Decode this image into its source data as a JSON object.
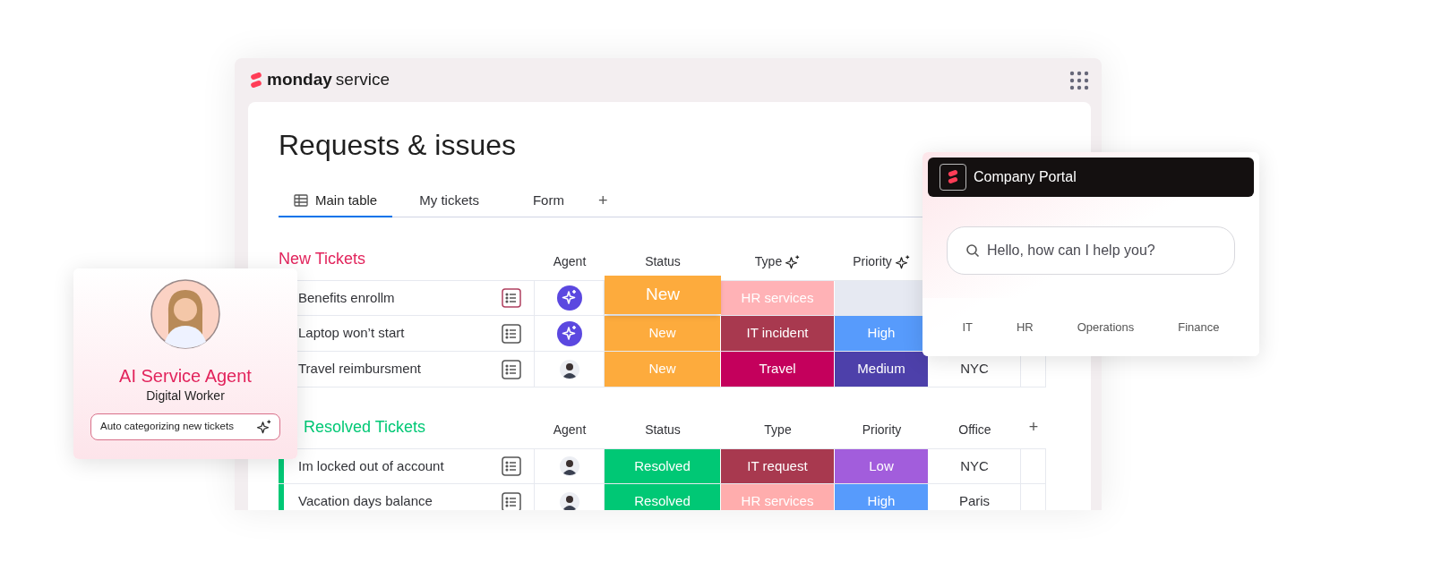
{
  "brand": {
    "name": "monday",
    "product": "service"
  },
  "board": {
    "title": "Requests & issues",
    "tabs": [
      {
        "label": "Main table",
        "selected": true
      },
      {
        "label": "My tickets",
        "selected": false
      },
      {
        "label": "Form",
        "selected": false
      }
    ],
    "add_tab": "+"
  },
  "groups": [
    {
      "title": "New Tickets",
      "color": "#e2245c",
      "columns": [
        {
          "label": "Agent",
          "ai": false
        },
        {
          "label": "Status",
          "ai": false
        },
        {
          "label": "Type",
          "ai": true
        },
        {
          "label": "Priority",
          "ai": true
        }
      ],
      "rows": [
        {
          "name": "Benefits enrollm",
          "agent": {
            "kind": "ai"
          },
          "status": {
            "label": "New",
            "color": "#fdab3d",
            "emphasized": true
          },
          "type": {
            "label": "HR services",
            "color": "#ffb2b6"
          },
          "priority": {
            "color": "#e6e9f2"
          }
        },
        {
          "name": "Laptop won’t start",
          "agent": {
            "kind": "ai"
          },
          "status": {
            "label": "New",
            "color": "#fdab3d",
            "emphasized": false
          },
          "type": {
            "label": "IT incident",
            "color": "#a8394f"
          },
          "priority": {
            "label": "High",
            "color": "#579bfc"
          }
        },
        {
          "name": "Travel reimbursment",
          "agent": {
            "kind": "person"
          },
          "status": {
            "label": "New",
            "color": "#fdab3d",
            "emphasized": false
          },
          "type": {
            "label": "Travel",
            "color": "#c4005c"
          },
          "priority": {
            "label": "Medium",
            "color": "#4d40aa"
          },
          "office": "NYC"
        }
      ]
    },
    {
      "title": "Resolved Tickets",
      "color": "#00c875",
      "columns": [
        {
          "label": "Agent",
          "ai": false
        },
        {
          "label": "Status",
          "ai": false
        },
        {
          "label": "Type",
          "ai": false
        },
        {
          "label": "Priority",
          "ai": false
        },
        {
          "label": "Office",
          "ai": false
        }
      ],
      "add_column": "+",
      "rows": [
        {
          "name": "Im locked out of account",
          "agent": {
            "kind": "person"
          },
          "status": {
            "label": "Resolved",
            "color": "#00c875",
            "emphasized": false
          },
          "type": {
            "label": "IT request",
            "color": "#a8394f"
          },
          "priority": {
            "label": "Low",
            "color": "#a25ddc"
          },
          "office": "NYC"
        },
        {
          "name": "Vacation days balance",
          "agent": {
            "kind": "person"
          },
          "status": {
            "label": "Resolved",
            "color": "#00c875",
            "emphasized": false
          },
          "type": {
            "label": "HR services",
            "color": "#ffadad"
          },
          "priority": {
            "label": "High",
            "color": "#579bfc"
          },
          "office": "Paris"
        }
      ]
    }
  ],
  "agent_card": {
    "title": "AI Service Agent",
    "subtitle": "Digital Worker",
    "task": "Auto categorizing new tickets"
  },
  "portal": {
    "title": "Company Portal",
    "placeholder": "Hello, how can I help you?",
    "categories": [
      "IT",
      "HR",
      "Operations",
      "Finance"
    ]
  }
}
